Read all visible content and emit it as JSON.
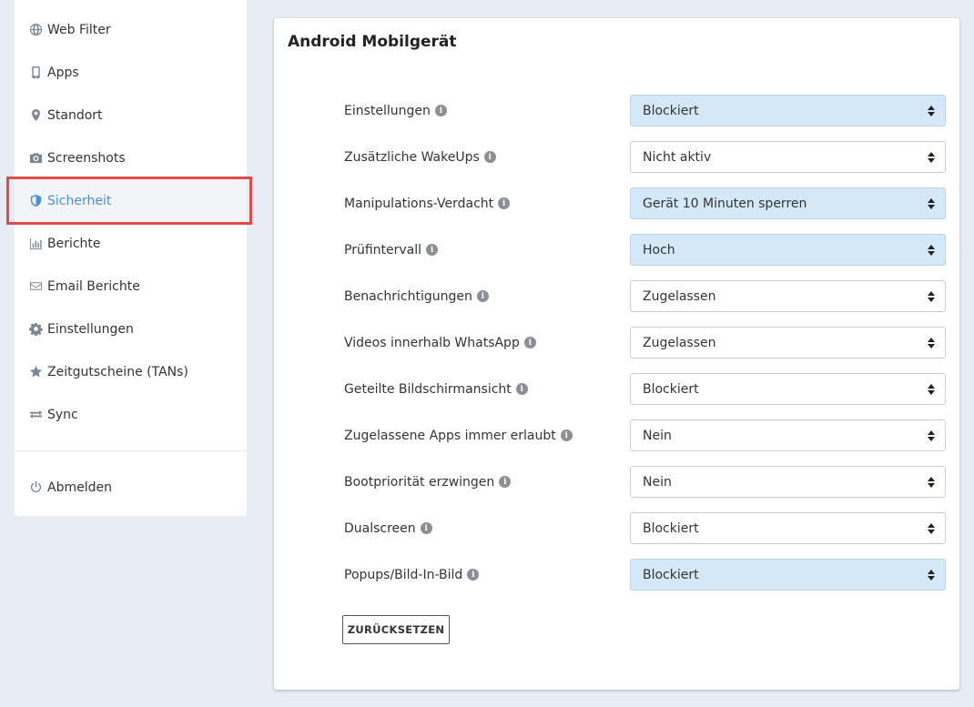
{
  "sidebar": {
    "items": [
      {
        "label": "Web Filter",
        "icon": "globe-icon"
      },
      {
        "label": "Apps",
        "icon": "phone-icon"
      },
      {
        "label": "Standort",
        "icon": "map-pin-icon"
      },
      {
        "label": "Screenshots",
        "icon": "camera-icon"
      },
      {
        "label": "Sicherheit",
        "icon": "shield-icon",
        "active": true
      },
      {
        "label": "Berichte",
        "icon": "bar-chart-icon"
      },
      {
        "label": "Email Berichte",
        "icon": "envelope-icon"
      },
      {
        "label": "Einstellungen",
        "icon": "gear-icon"
      },
      {
        "label": "Zeitgutscheine (TANs)",
        "icon": "star-icon"
      },
      {
        "label": "Sync",
        "icon": "sync-arrows-icon"
      }
    ],
    "logout": {
      "label": "Abmelden",
      "icon": "power-icon"
    }
  },
  "card": {
    "title": "Android Mobilgerät",
    "settings": [
      {
        "label": "Einstellungen",
        "value": "Blockiert",
        "highlighted": true
      },
      {
        "label": "Zusätzliche WakeUps",
        "value": "Nicht aktiv",
        "highlighted": false
      },
      {
        "label": "Manipulations-Verdacht",
        "value": "Gerät 10 Minuten sperren",
        "highlighted": true
      },
      {
        "label": "Prüfintervall",
        "value": "Hoch",
        "highlighted": true
      },
      {
        "label": "Benachrichtigungen",
        "value": "Zugelassen",
        "highlighted": false
      },
      {
        "label": "Videos innerhalb WhatsApp",
        "value": "Zugelassen",
        "highlighted": false
      },
      {
        "label": "Geteilte Bildschirmansicht",
        "value": "Blockiert",
        "highlighted": false
      },
      {
        "label": "Zugelassene Apps immer erlaubt",
        "value": "Nein",
        "highlighted": false
      },
      {
        "label": "Bootpriorität erzwingen",
        "value": "Nein",
        "highlighted": false
      },
      {
        "label": "Dualscreen",
        "value": "Blockiert",
        "highlighted": false
      },
      {
        "label": "Popups/Bild-In-Bild",
        "value": "Blockiert",
        "highlighted": true
      }
    ],
    "reset_label": "ZURÜCKSETZEN",
    "info_glyph": "i"
  },
  "colors": {
    "accent": "#4a90d9",
    "highlight_select": "#d4e8f8",
    "annotation_box": "#e24a4a",
    "background": "#e8ecf3"
  }
}
